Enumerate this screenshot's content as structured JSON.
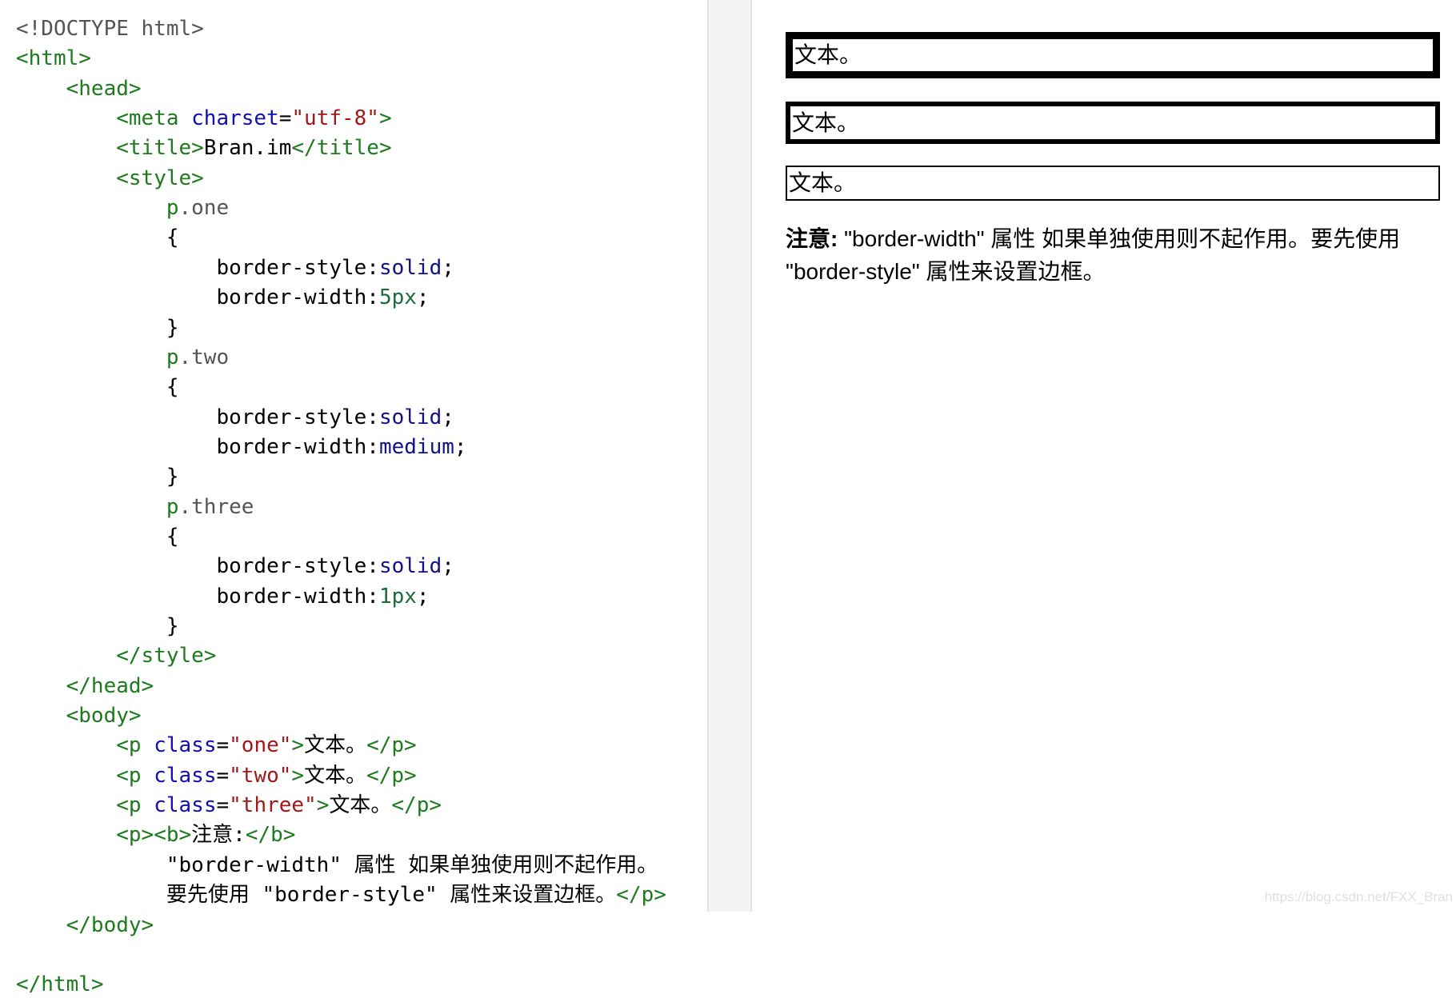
{
  "editor": {
    "lines": [
      {
        "segments": [
          {
            "t": "<!DOCTYPE html>",
            "c": "doctype"
          }
        ]
      },
      {
        "segments": [
          {
            "t": "<html>",
            "c": "tag"
          }
        ]
      },
      {
        "segments": [
          {
            "t": "    ",
            "c": "plain"
          },
          {
            "t": "<head>",
            "c": "tag"
          }
        ]
      },
      {
        "segments": [
          {
            "t": "        ",
            "c": "plain"
          },
          {
            "t": "<meta ",
            "c": "tag"
          },
          {
            "t": "charset",
            "c": "attr"
          },
          {
            "t": "=",
            "c": "plain"
          },
          {
            "t": "\"utf-8\"",
            "c": "val"
          },
          {
            "t": ">",
            "c": "tag"
          }
        ]
      },
      {
        "segments": [
          {
            "t": "        ",
            "c": "plain"
          },
          {
            "t": "<title>",
            "c": "tag"
          },
          {
            "t": "Bran.im",
            "c": "plain"
          },
          {
            "t": "</title>",
            "c": "tag"
          }
        ]
      },
      {
        "segments": [
          {
            "t": "        ",
            "c": "plain"
          },
          {
            "t": "<style>",
            "c": "tag"
          }
        ]
      },
      {
        "segments": [
          {
            "t": "            ",
            "c": "plain"
          },
          {
            "t": "p",
            "c": "tag"
          },
          {
            "t": ".one",
            "c": "cls"
          }
        ]
      },
      {
        "segments": [
          {
            "t": "            {",
            "c": "plain"
          }
        ]
      },
      {
        "segments": [
          {
            "t": "                border-style:",
            "c": "plain"
          },
          {
            "t": "solid",
            "c": "kw"
          },
          {
            "t": ";",
            "c": "plain"
          }
        ]
      },
      {
        "segments": [
          {
            "t": "                border-width:",
            "c": "plain"
          },
          {
            "t": "5px",
            "c": "num"
          },
          {
            "t": ";",
            "c": "plain"
          }
        ]
      },
      {
        "segments": [
          {
            "t": "            }",
            "c": "plain"
          }
        ]
      },
      {
        "segments": [
          {
            "t": "            ",
            "c": "plain"
          },
          {
            "t": "p",
            "c": "tag"
          },
          {
            "t": ".two",
            "c": "cls"
          }
        ]
      },
      {
        "segments": [
          {
            "t": "            {",
            "c": "plain"
          }
        ]
      },
      {
        "segments": [
          {
            "t": "                border-style:",
            "c": "plain"
          },
          {
            "t": "solid",
            "c": "kw"
          },
          {
            "t": ";",
            "c": "plain"
          }
        ]
      },
      {
        "segments": [
          {
            "t": "                border-width:",
            "c": "plain"
          },
          {
            "t": "medium",
            "c": "kw"
          },
          {
            "t": ";",
            "c": "plain"
          }
        ]
      },
      {
        "segments": [
          {
            "t": "            }",
            "c": "plain"
          }
        ]
      },
      {
        "segments": [
          {
            "t": "            ",
            "c": "plain"
          },
          {
            "t": "p",
            "c": "tag"
          },
          {
            "t": ".three",
            "c": "cls"
          }
        ]
      },
      {
        "segments": [
          {
            "t": "            {",
            "c": "plain"
          }
        ]
      },
      {
        "segments": [
          {
            "t": "                border-style:",
            "c": "plain"
          },
          {
            "t": "solid",
            "c": "kw"
          },
          {
            "t": ";",
            "c": "plain"
          }
        ]
      },
      {
        "segments": [
          {
            "t": "                border-width:",
            "c": "plain"
          },
          {
            "t": "1px",
            "c": "num"
          },
          {
            "t": ";",
            "c": "plain"
          }
        ]
      },
      {
        "segments": [
          {
            "t": "            }",
            "c": "plain"
          }
        ]
      },
      {
        "segments": [
          {
            "t": "        ",
            "c": "plain"
          },
          {
            "t": "</style>",
            "c": "tag"
          }
        ]
      },
      {
        "segments": [
          {
            "t": "    ",
            "c": "plain"
          },
          {
            "t": "</head>",
            "c": "tag"
          }
        ]
      },
      {
        "segments": [
          {
            "t": "    ",
            "c": "plain"
          },
          {
            "t": "<body>",
            "c": "tag"
          }
        ]
      },
      {
        "segments": [
          {
            "t": "        ",
            "c": "plain"
          },
          {
            "t": "<p ",
            "c": "tag"
          },
          {
            "t": "class",
            "c": "attr"
          },
          {
            "t": "=",
            "c": "plain"
          },
          {
            "t": "\"one\"",
            "c": "val"
          },
          {
            "t": ">",
            "c": "tag"
          },
          {
            "t": "文本。",
            "c": "plain"
          },
          {
            "t": "</p>",
            "c": "tag"
          }
        ]
      },
      {
        "segments": [
          {
            "t": "        ",
            "c": "plain"
          },
          {
            "t": "<p ",
            "c": "tag"
          },
          {
            "t": "class",
            "c": "attr"
          },
          {
            "t": "=",
            "c": "plain"
          },
          {
            "t": "\"two\"",
            "c": "val"
          },
          {
            "t": ">",
            "c": "tag"
          },
          {
            "t": "文本。",
            "c": "plain"
          },
          {
            "t": "</p>",
            "c": "tag"
          }
        ]
      },
      {
        "segments": [
          {
            "t": "        ",
            "c": "plain"
          },
          {
            "t": "<p ",
            "c": "tag"
          },
          {
            "t": "class",
            "c": "attr"
          },
          {
            "t": "=",
            "c": "plain"
          },
          {
            "t": "\"three\"",
            "c": "val"
          },
          {
            "t": ">",
            "c": "tag"
          },
          {
            "t": "文本。",
            "c": "plain"
          },
          {
            "t": "</p>",
            "c": "tag"
          }
        ]
      },
      {
        "segments": [
          {
            "t": "        ",
            "c": "plain"
          },
          {
            "t": "<p><b>",
            "c": "tag"
          },
          {
            "t": "注意:",
            "c": "plain"
          },
          {
            "t": "</b>",
            "c": "tag"
          }
        ]
      },
      {
        "segments": [
          {
            "t": "            \"border-width\" 属性 如果单独使用则不起作用。",
            "c": "plain"
          }
        ]
      },
      {
        "segments": [
          {
            "t": "            要先使用 \"border-style\" 属性来设置边框。",
            "c": "plain"
          },
          {
            "t": "</p>",
            "c": "tag"
          }
        ]
      },
      {
        "segments": [
          {
            "t": "    ",
            "c": "plain"
          },
          {
            "t": "</body>",
            "c": "tag"
          }
        ]
      },
      {
        "segments": []
      },
      {
        "segments": [
          {
            "t": "</html>",
            "c": "tag"
          }
        ]
      }
    ]
  },
  "preview": {
    "box_one": "文本。",
    "box_two": "文本。",
    "box_three": "文本。",
    "note_bold": "注意:",
    "note_text": " \"border-width\" 属性 如果单独使用则不起作用。要先使用 \"border-style\" 属性来设置边框。"
  },
  "watermark": "https://blog.csdn.net/FXX_Bran"
}
